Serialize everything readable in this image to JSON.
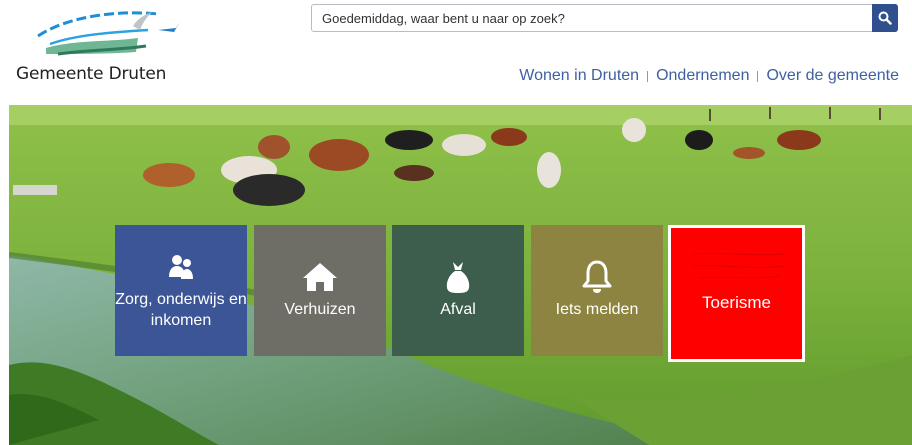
{
  "logo": {
    "name": "Gemeente Druten"
  },
  "search": {
    "placeholder": "Goedemiddag, waar bent u naar op zoek?"
  },
  "nav": {
    "items": [
      "Wonen in Druten",
      "Ondernemen",
      "Over de gemeente"
    ]
  },
  "tiles": [
    {
      "label": "Zorg, onderwijs en inkomen",
      "icon": "people-icon",
      "color": "#3b5596"
    },
    {
      "label": "Verhuizen",
      "icon": "home-icon",
      "color": "#6f6e66"
    },
    {
      "label": "Afval",
      "icon": "trash-bag-icon",
      "color": "#3d5d4d"
    },
    {
      "label": "Iets melden",
      "icon": "bell-icon",
      "color": "#8e8441"
    },
    {
      "label": "Toerisme",
      "icon": "",
      "color": "#ff0000"
    }
  ],
  "colors": {
    "brand": "#3e5fa0",
    "search_button": "#2f4f8f"
  }
}
